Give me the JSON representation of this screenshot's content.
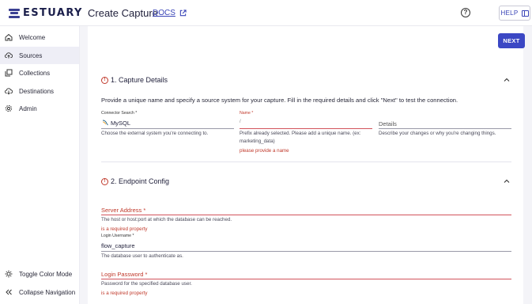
{
  "header": {
    "logo_text": "ESTUARY",
    "title": "Create Capture",
    "docs_label": "DOCS",
    "help_label": "HELP"
  },
  "sidebar": {
    "items": [
      {
        "label": "Welcome",
        "icon": "home-icon"
      },
      {
        "label": "Sources",
        "icon": "cloud-upload-icon",
        "active": true
      },
      {
        "label": "Collections",
        "icon": "collections-icon"
      },
      {
        "label": "Destinations",
        "icon": "cloud-download-icon"
      },
      {
        "label": "Admin",
        "icon": "gear-icon"
      }
    ],
    "footer": [
      {
        "label": "Toggle Color Mode",
        "icon": "sun-icon"
      },
      {
        "label": "Collapse Navigation",
        "icon": "double-chevron-left-icon"
      }
    ]
  },
  "main": {
    "next_label": "NEXT",
    "capture_details": {
      "title": "1. Capture Details",
      "description": "Provide a unique name and specify a source system for your capture. Fill in the required details and click \"Next\" to test the connection.",
      "connector": {
        "label": "Connector Search *",
        "value": "MySQL",
        "helper": "Choose the external system you're connecting to."
      },
      "name": {
        "label": "Name *",
        "value": "/",
        "helper_line1": "Prefix already selected. Please add a unique name. (ex:",
        "helper_line2": "marketing_data)",
        "error": "please provide a name"
      },
      "details": {
        "placeholder": "Details",
        "helper": "Describe your changes or why you're changing things."
      }
    },
    "endpoint_config": {
      "title": "2. Endpoint Config",
      "server_address": {
        "placeholder": "Server Address *",
        "helper": "The host or host:port at which the database can be reached.",
        "error": "is a required property"
      },
      "login_username": {
        "label": "Login Username *",
        "value": "flow_capture",
        "helper": "The database user to authenticate as."
      },
      "login_password": {
        "placeholder": "Login Password *",
        "helper": "Password for the specified database user.",
        "error": "is a required property"
      }
    }
  },
  "colors": {
    "accent": "#3b47c4",
    "error": "#c0392b",
    "logo": "#3a3f92"
  }
}
